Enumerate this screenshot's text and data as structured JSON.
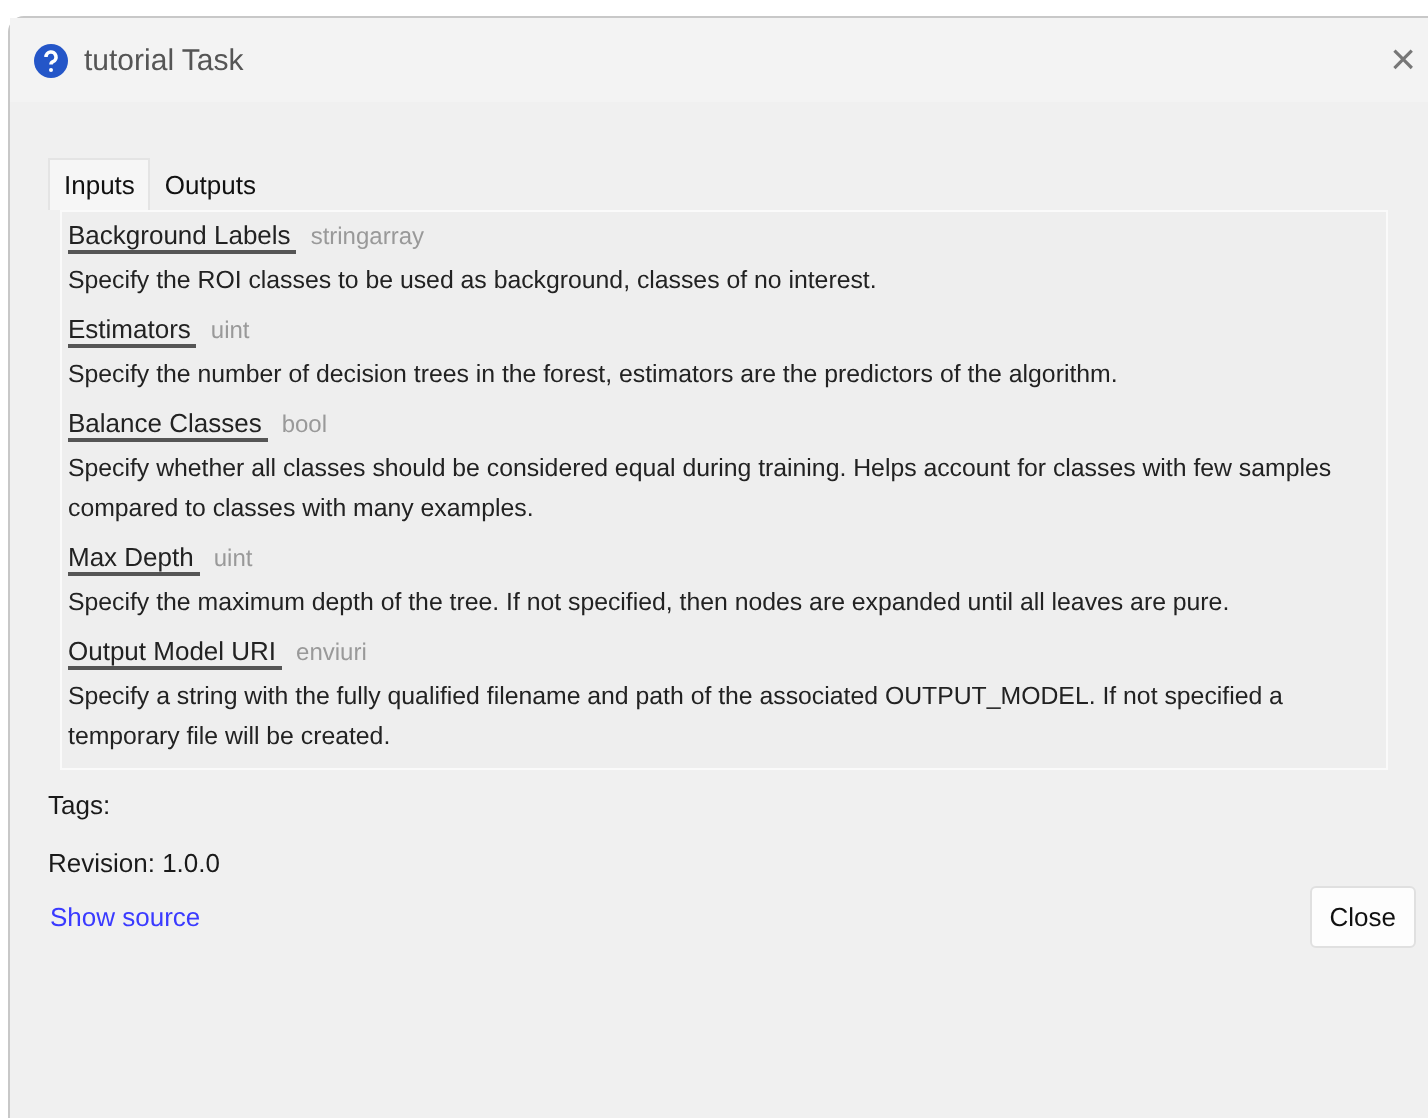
{
  "window": {
    "title": "tutorial Task",
    "close": "×"
  },
  "tabs": [
    {
      "label": "Inputs",
      "selected": true
    },
    {
      "label": "Outputs",
      "selected": false
    }
  ],
  "parameters": [
    {
      "name": "Background Labels",
      "type": "stringarray",
      "description": "Specify the ROI classes to be used as background, classes of no interest."
    },
    {
      "name": "Estimators",
      "type": "uint",
      "description": "Specify the number of decision trees in the forest, estimators are the predictors of the algorithm."
    },
    {
      "name": "Balance Classes",
      "type": "bool",
      "description": "Specify whether all classes should be considered equal during training. Helps account for classes with few samples compared to classes with many examples."
    },
    {
      "name": "Max Depth",
      "type": "uint",
      "description": "Specify the maximum depth of the tree. If not specified, then nodes are expanded until all leaves are pure."
    },
    {
      "name": "Output Model URI",
      "type": "enviuri",
      "description": "Specify a string with the fully qualified filename and path of the associated OUTPUT_MODEL. If not specified a temporary file will be created."
    }
  ],
  "tags": "Tags:",
  "revision": "Revision: 1.0.0",
  "show_source": "Show source",
  "close_button": "Close"
}
